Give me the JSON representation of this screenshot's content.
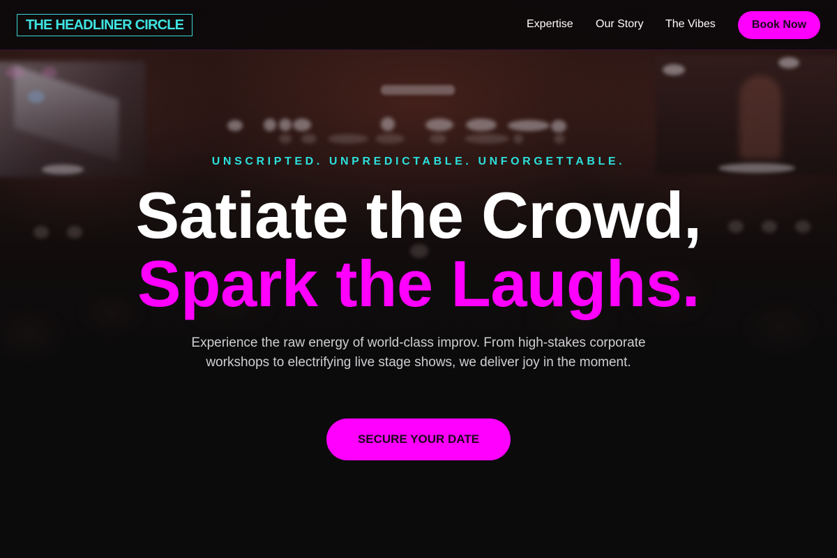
{
  "navbar": {
    "logo_text": "THE HEADLINER CIRCLE",
    "links": [
      {
        "label": "Expertise"
      },
      {
        "label": "Our Story"
      },
      {
        "label": "The Vibes"
      }
    ],
    "cta_label": "Book Now"
  },
  "hero": {
    "tagline": "UNSCRIPTED. UNPREDICTABLE. UNFORGETTABLE.",
    "headline_line1": "Satiate the Crowd,",
    "headline_line2": "Spark the Laughs.",
    "description": "Experience the raw energy of world-class improv. From high-stakes corporate workshops to electrifying live stage shows, we deliver joy in the moment.",
    "cta_label": "SECURE YOUR DATE",
    "background": "blurred-concert-stage-photo"
  },
  "colors": {
    "accent_magenta": "#ff00ff",
    "accent_cyan": "#3ee4e2",
    "page_background": "#0b0b0c",
    "text_primary": "#ffffff",
    "text_muted": "#cfcfd2"
  }
}
